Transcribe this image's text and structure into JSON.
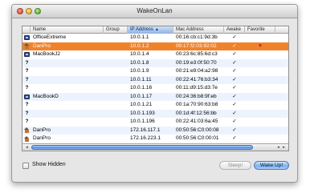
{
  "window": {
    "title": "WakeOnLan"
  },
  "colors": {
    "selected_row": "#f0832a",
    "sort_header": "#8fb2e2",
    "scroll_thumb": "#4e8ee3",
    "heart": "#c0261f"
  },
  "table": {
    "columns": {
      "name": "Name",
      "group": "Group",
      "ip": "IP Address",
      "mac": "Mac Address",
      "awake": "Awake",
      "favorite": "Favorite"
    },
    "sort_indicator": "▲",
    "rows": [
      {
        "icon": "mac-icon",
        "icon_text": "",
        "name": "OfficeExtreme",
        "group": "",
        "ip": "10.0.1.1",
        "mac": "00:16:cb:c1:9d:3b",
        "awake": "✓",
        "favorite": ""
      },
      {
        "icon": "network-icon",
        "icon_text": "",
        "name": "DanPro",
        "group": "",
        "ip": "10.0.1.2",
        "mac": "00:17:f2:03:92:02",
        "awake": "✓",
        "favorite": "♥"
      },
      {
        "icon": "mac-icon",
        "icon_text": "",
        "name": "MacBookJ2",
        "group": "",
        "ip": "10.0.1.4",
        "mac": "00:23:6c:85:6d:c3",
        "awake": "✓",
        "favorite": ""
      },
      {
        "icon": "unknown-icon",
        "icon_text": "?",
        "name": "",
        "group": "",
        "ip": "10.0.1.8",
        "mac": "00:19:e3:0f:50:70",
        "awake": "✓",
        "favorite": ""
      },
      {
        "icon": "unknown-icon",
        "icon_text": "?",
        "name": "",
        "group": "",
        "ip": "10.0.1.9",
        "mac": "00:21:e9:04:a2:98",
        "awake": "✓",
        "favorite": ""
      },
      {
        "icon": "unknown-icon",
        "icon_text": "?",
        "name": "",
        "group": "",
        "ip": "10.0.1.11",
        "mac": "00:22:41:76:b3:34",
        "awake": "✓",
        "favorite": ""
      },
      {
        "icon": "unknown-icon",
        "icon_text": "?",
        "name": "",
        "group": "",
        "ip": "10.0.1.16",
        "mac": "00:11:d9:15:d3:7e",
        "awake": "✓",
        "favorite": ""
      },
      {
        "icon": "mac-icon",
        "icon_text": "",
        "name": "MacBookD",
        "group": "",
        "ip": "10.0.1.17",
        "mac": "00:24:36:b8:9f:eb",
        "awake": "✓",
        "favorite": ""
      },
      {
        "icon": "unknown-icon",
        "icon_text": "?",
        "name": "",
        "group": "",
        "ip": "10.0.1.21",
        "mac": "00:1a:70:90:63:b8",
        "awake": "✓",
        "favorite": ""
      },
      {
        "icon": "unknown-icon",
        "icon_text": "?",
        "name": "",
        "group": "",
        "ip": "10.0.1.193",
        "mac": "00:1d:4f:12:56:bb",
        "awake": "✓",
        "favorite": ""
      },
      {
        "icon": "unknown-icon",
        "icon_text": "?",
        "name": "",
        "group": "",
        "ip": "10.0.1.196",
        "mac": "00:22:41:03:6a:45",
        "awake": "✓",
        "favorite": ""
      },
      {
        "icon": "network-icon",
        "icon_text": "",
        "name": "DanPro",
        "group": "",
        "ip": "172.16.117.1",
        "mac": "00:50:56:C0:00:08",
        "awake": "✓",
        "favorite": ""
      },
      {
        "icon": "network-icon",
        "icon_text": "",
        "name": "DanPro",
        "group": "",
        "ip": "172.16.223.1",
        "mac": "00:50:56:C0:00:01",
        "awake": "✓",
        "favorite": ""
      }
    ],
    "selected_row": 1
  },
  "scrollbar": {
    "left_arrow": "◂",
    "right_arrows": [
      "◂",
      "▸"
    ]
  },
  "footer": {
    "show_hidden_label": "Show Hidden",
    "sleep_label": "Sleep!",
    "wake_label": "Wake Up!"
  }
}
